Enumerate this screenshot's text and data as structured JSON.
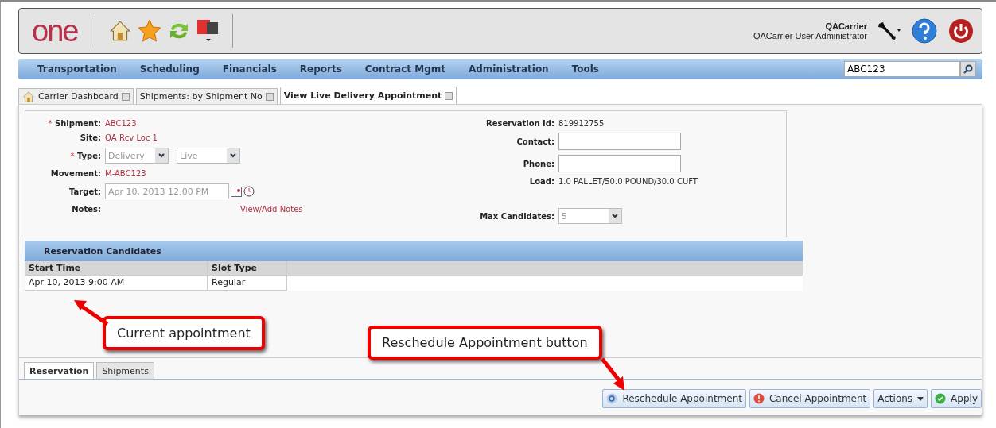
{
  "header": {
    "logo": "one",
    "user_name": "QACarrier",
    "user_role": "QACarrier User Administrator"
  },
  "nav": {
    "items": [
      "Transportation",
      "Scheduling",
      "Financials",
      "Reports",
      "Contract Mgmt",
      "Administration",
      "Tools"
    ],
    "search_value": "ABC123"
  },
  "tabs": [
    {
      "label": "Carrier Dashboard",
      "selected": false,
      "home": true
    },
    {
      "label": "Shipments: by Shipment No",
      "selected": false,
      "home": false
    },
    {
      "label": "View Live Delivery Appointment",
      "selected": true,
      "home": false
    }
  ],
  "form_left": [
    {
      "kind": "text",
      "label": "Shipment:",
      "mark": "*",
      "value": "ABC123"
    },
    {
      "kind": "text",
      "label": "Site:",
      "value": "QA Rcv Loc 1"
    },
    {
      "kind": "selects",
      "label": "Type:",
      "mark": "*",
      "values": [
        "Delivery",
        "Live"
      ]
    },
    {
      "kind": "text",
      "label": "Movement:",
      "value": "M-ABC123"
    },
    {
      "kind": "date",
      "label": "Target:",
      "value": "Apr 10, 2013 12:00 PM"
    },
    {
      "kind": "link",
      "label": "Notes:",
      "value": "View/Add Notes"
    }
  ],
  "form_right": [
    {
      "kind": "plain",
      "label": "Reservation Id:",
      "value": "819912755"
    },
    {
      "kind": "input",
      "label": "Contact:"
    },
    {
      "kind": "input",
      "label": "Phone:"
    },
    {
      "kind": "plain",
      "label": "Load:",
      "value": "1.0 PALLET/50.0 POUND/30.0 CUFT"
    },
    {
      "kind": "select",
      "label": "Max Candidates:",
      "value": "5"
    }
  ],
  "candidates": {
    "title": "Reservation Candidates",
    "columns": [
      "Start Time",
      "Slot Type"
    ],
    "rows": [
      [
        "Apr 10, 2013 9:00 AM",
        "Regular"
      ]
    ]
  },
  "bottom_tabs": [
    {
      "label": "Reservation",
      "selected": true
    },
    {
      "label": "Shipments",
      "selected": false
    }
  ],
  "buttons": [
    {
      "kind": "reschedule",
      "label": "Reschedule Appointment"
    },
    {
      "kind": "cancel",
      "label": "Cancel Appointment"
    },
    {
      "kind": "menu",
      "label": "Actions"
    },
    {
      "kind": "apply",
      "label": "Apply"
    }
  ],
  "callouts": [
    "Current appointment",
    "Reschedule Appointment button"
  ]
}
